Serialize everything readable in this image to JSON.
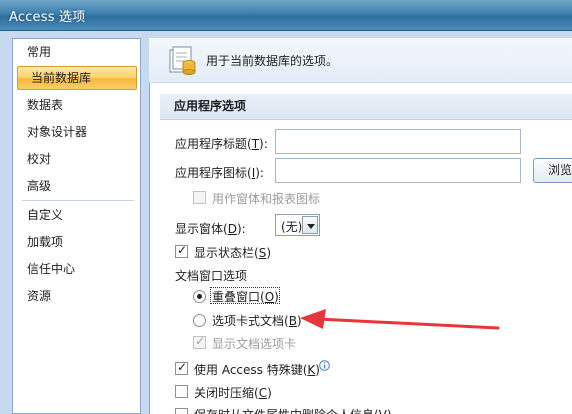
{
  "window": {
    "title": "Access 选项"
  },
  "nav": {
    "items": [
      {
        "label": "常用"
      },
      {
        "label": "当前数据库",
        "active": true
      },
      {
        "label": "数据表"
      },
      {
        "label": "对象设计器"
      },
      {
        "label": "校对"
      },
      {
        "label": "高级"
      },
      {
        "label": "自定义"
      },
      {
        "label": "加载项"
      },
      {
        "label": "信任中心"
      },
      {
        "label": "资源"
      }
    ]
  },
  "banner": {
    "text": "用于当前数据库的选项。"
  },
  "section": {
    "title": "应用程序选项"
  },
  "fields": {
    "app_title": {
      "label": "应用程序标题(",
      "accel": "T",
      "suffix": "):",
      "value": ""
    },
    "app_icon": {
      "label": "应用程序图标(",
      "accel": "I",
      "suffix": "):",
      "value": ""
    },
    "browse_button": "浏览",
    "use_as_icon": {
      "label": "用作窗体和报表图标",
      "checked": false,
      "enabled": false
    },
    "display_form": {
      "label": "显示窗体(",
      "accel": "D",
      "suffix": "):",
      "value": "(无)"
    },
    "status_bar": {
      "label": "显示状态栏(",
      "accel": "S",
      "suffix": ")",
      "checked": true
    },
    "doc_window_options": "文档窗口选项",
    "overlapping": {
      "label": "重叠窗口(",
      "accel": "O",
      "suffix": ")",
      "selected": true
    },
    "tabbed": {
      "label": "选项卡式文档(",
      "accel": "B",
      "suffix": ")",
      "selected": false
    },
    "show_tabs": {
      "label": "显示文档选项卡",
      "checked": true,
      "enabled": false
    },
    "special_keys": {
      "label": "使用 Access 特殊键(",
      "accel": "K",
      "suffix": ")",
      "checked": true
    },
    "compact_on_close": {
      "label": "关闭时压缩(",
      "accel": "C",
      "suffix": ")",
      "checked": false
    },
    "remove_personal": {
      "label": "保存时从文件属性中删除个人信息(V)",
      "checked": false
    }
  },
  "colors": {
    "arrow": "#e8353a",
    "active_nav": "#f9cf6b",
    "title_bar": "#3f7fae"
  }
}
